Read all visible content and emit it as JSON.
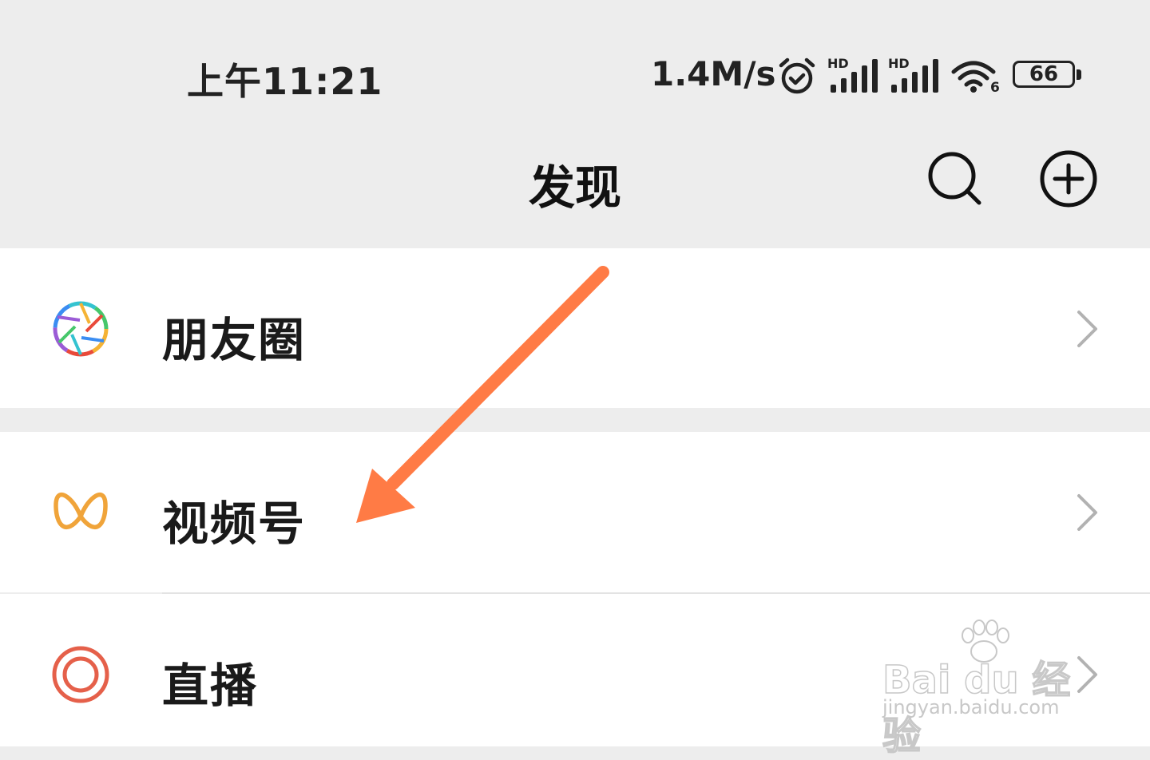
{
  "status_bar": {
    "time": "上午11:21",
    "net_speed": "1.4M/s",
    "signal1_tag": "HD",
    "signal2_tag": "HD",
    "wifi_tag": "6",
    "battery": "66",
    "icons": [
      "alarm-icon",
      "signal-hd-icon",
      "signal-hd-icon",
      "wifi-6-icon",
      "battery-icon"
    ]
  },
  "nav": {
    "title": "发现",
    "icons": [
      "search-icon",
      "add-circle-icon"
    ]
  },
  "menu": {
    "items": [
      {
        "label": "朋友圈",
        "icon": "moments-aperture-icon"
      },
      {
        "label": "视频号",
        "icon": "channels-icon",
        "icon_color": "#f0a43a"
      },
      {
        "label": "直播",
        "icon": "live-icon",
        "icon_color": "#e5604a"
      }
    ]
  },
  "annotation": {
    "arrow_color": "#ff7b45",
    "icon": "arrow-annotation"
  },
  "watermark": {
    "main": "Bai du 经验",
    "url": "jingyan.baidu.com"
  },
  "colors": {
    "background": "#ededed",
    "row_bg": "#ffffff",
    "text": "#1a1a1a",
    "chevron": "#b2b2b2"
  }
}
